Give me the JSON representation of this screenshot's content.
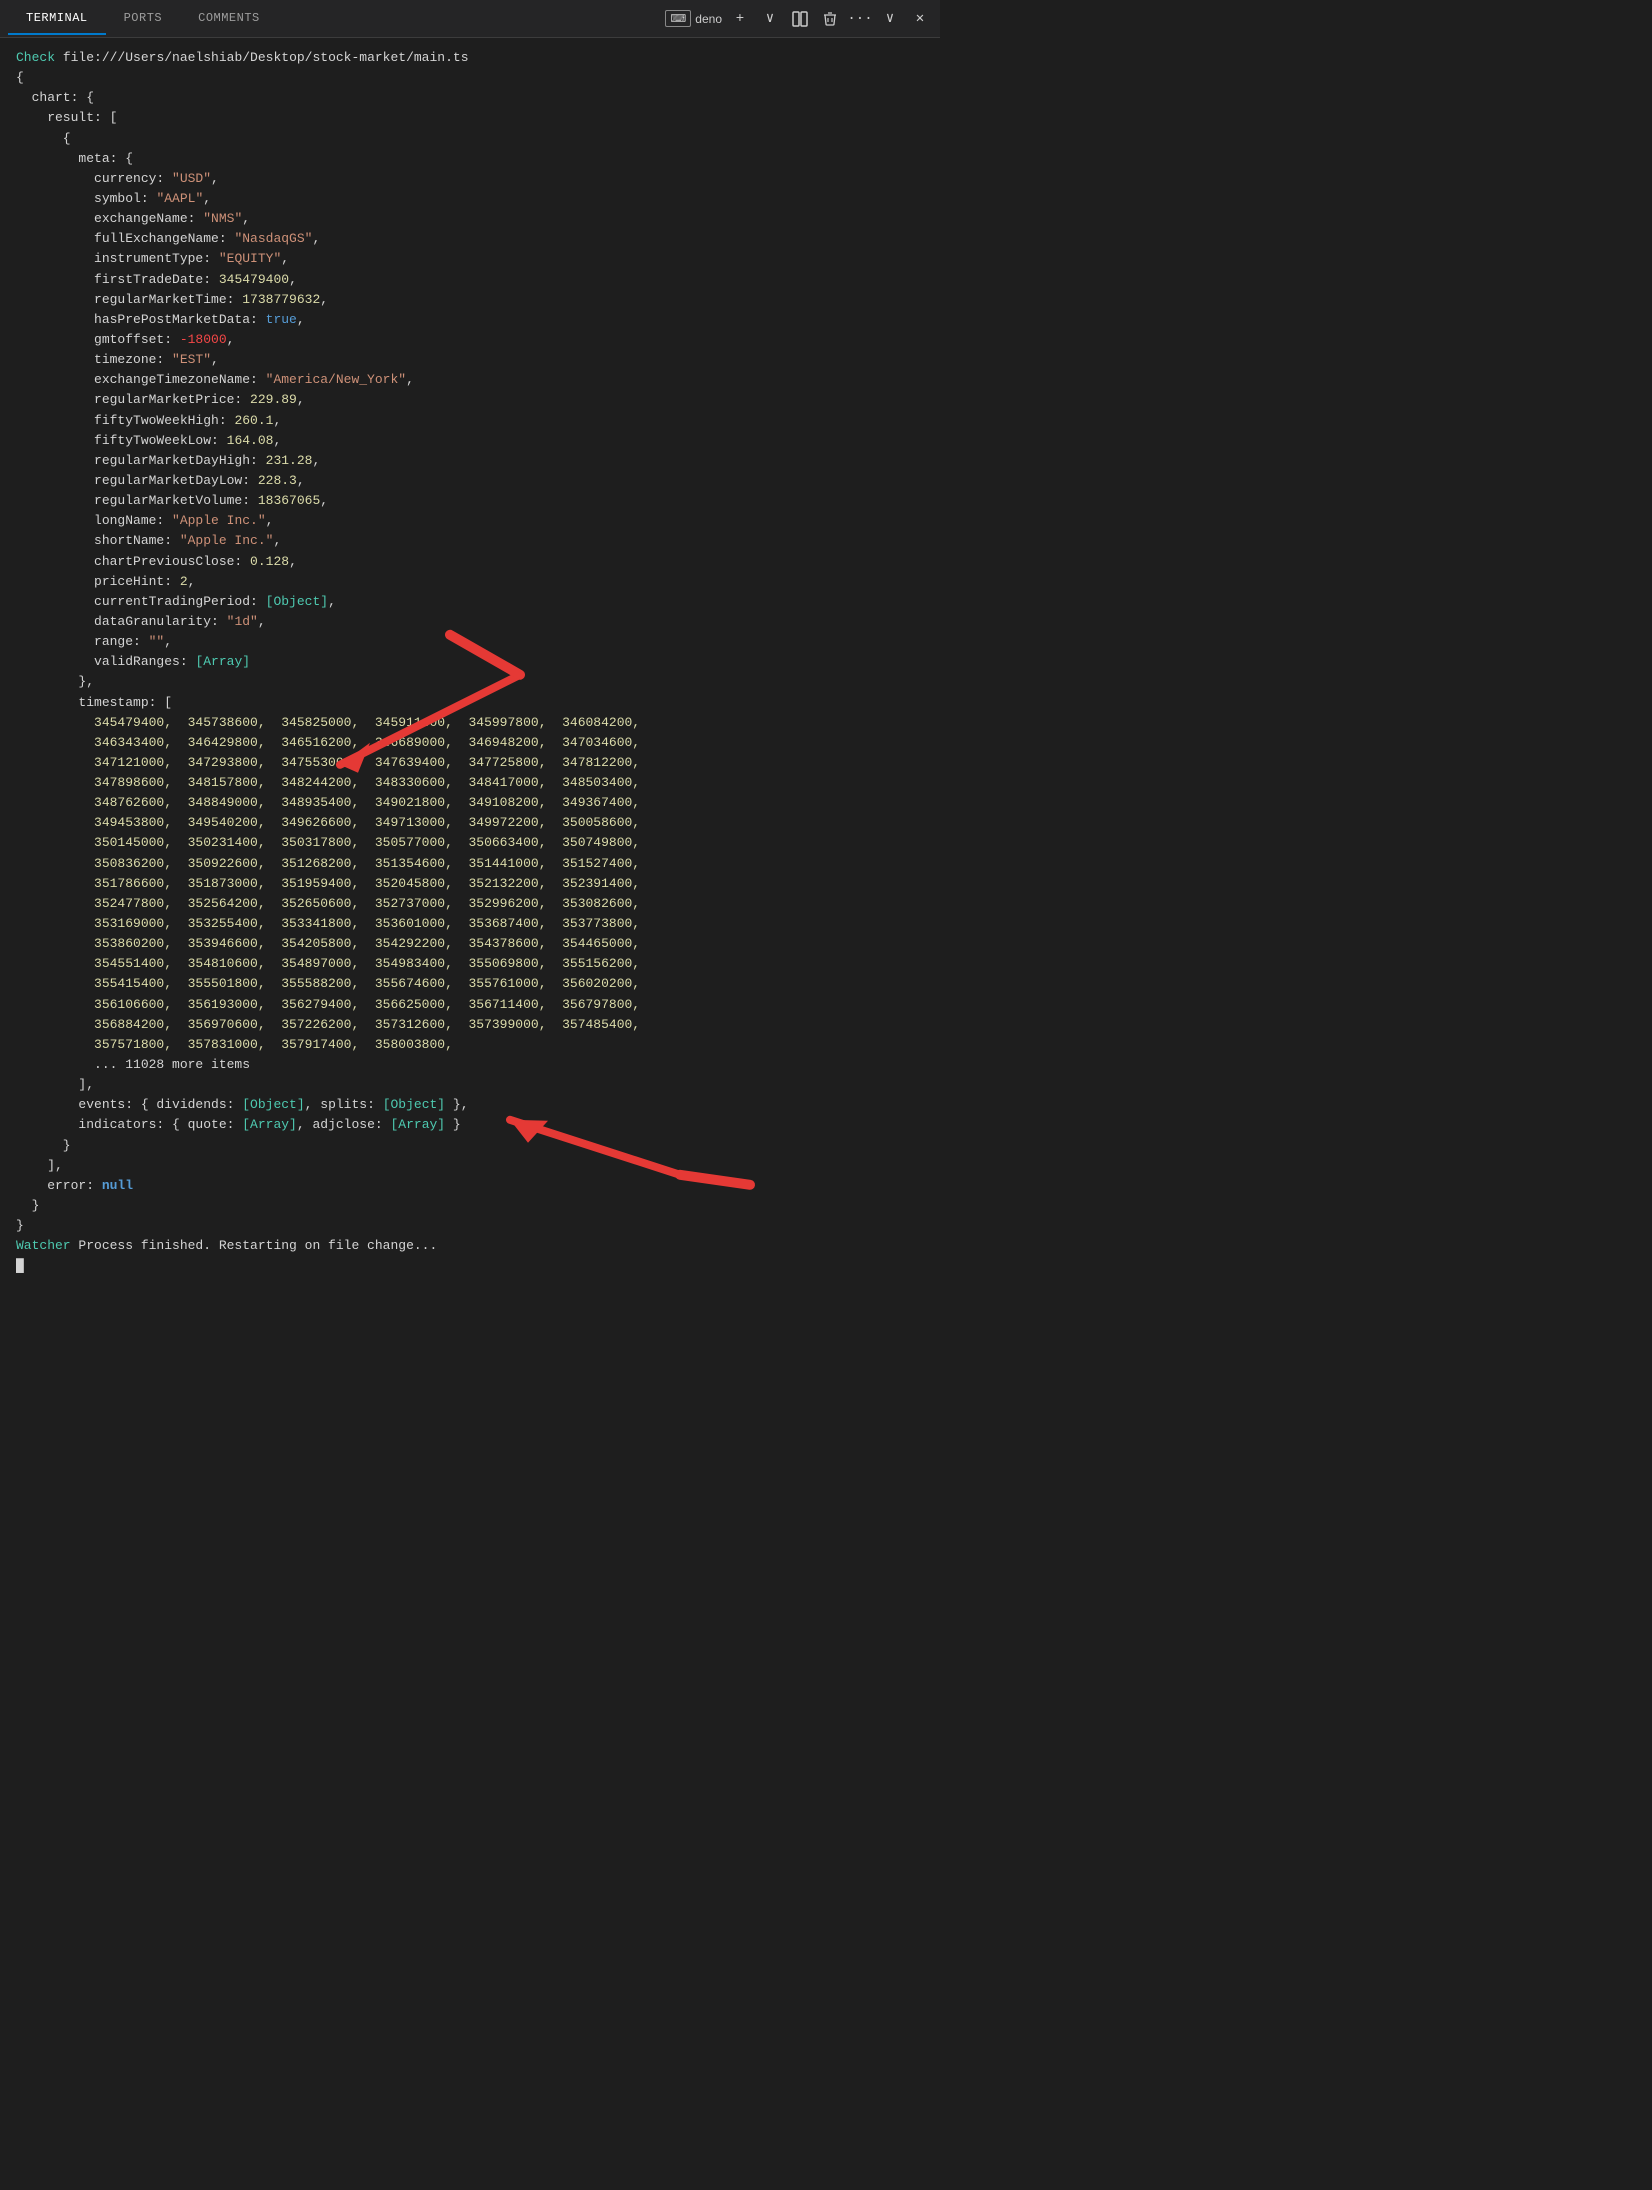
{
  "tabs": [
    {
      "label": "TERMINAL",
      "active": true
    },
    {
      "label": "PORTS",
      "active": false
    },
    {
      "label": "COMMENTS",
      "active": false
    }
  ],
  "toolbar": {
    "deno_label": "deno",
    "add_icon": "+",
    "split_icon": "⊞",
    "trash_icon": "🗑",
    "more_icon": "···",
    "chevron_icon": "∨",
    "close_icon": "✕"
  },
  "terminal": {
    "check_line": "Check file:///Users/naelshiab/Desktop/stock-market/main.ts",
    "more_items": "... 11028 more items"
  }
}
